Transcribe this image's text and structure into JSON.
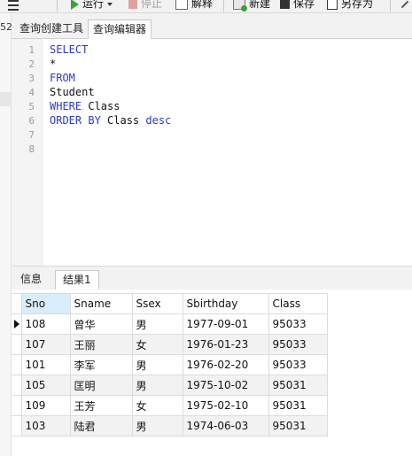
{
  "toolbar": {
    "run_label": "运行",
    "stop_label": "停止",
    "explain_label": "解释",
    "new_label": "新建",
    "save_label": "保存",
    "save_as_label": "另存为"
  },
  "left_panel": {
    "partial_text": "52"
  },
  "query_tabs": [
    {
      "label": "查询创建工具",
      "active": false
    },
    {
      "label": "查询编辑器",
      "active": true
    }
  ],
  "editor": {
    "line_numbers": [
      "1",
      "2",
      "3",
      "4",
      "5",
      "6",
      "7",
      "8"
    ],
    "lines": [
      [
        {
          "t": "SELECT",
          "kw": true
        }
      ],
      [
        {
          "t": "*",
          "kw": false
        }
      ],
      [
        {
          "t": "FROM",
          "kw": true
        }
      ],
      [
        {
          "t": "Student",
          "kw": false
        }
      ],
      [
        {
          "t": "WHERE",
          "kw": true
        },
        {
          "t": " Class",
          "kw": false
        }
      ],
      [
        {
          "t": "ORDER BY",
          "kw": true
        },
        {
          "t": " Class ",
          "kw": false
        },
        {
          "t": "desc",
          "kw": true
        }
      ],
      [],
      []
    ],
    "keyword_color": "#2b3cc2"
  },
  "result_tabs": [
    {
      "label": "信息",
      "active": false
    },
    {
      "label": "结果1",
      "active": true
    }
  ],
  "grid": {
    "columns": [
      "Sno",
      "Sname",
      "Ssex",
      "Sbirthday",
      "Class"
    ],
    "rows": [
      [
        "108",
        "曾华",
        "男",
        "1977-09-01",
        "95033"
      ],
      [
        "107",
        "王丽",
        "女",
        "1976-01-23",
        "95033"
      ],
      [
        "101",
        "李军",
        "男",
        "1976-02-20",
        "95033"
      ],
      [
        "105",
        "匡明",
        "男",
        "1975-10-02",
        "95031"
      ],
      [
        "109",
        "王芳",
        "女",
        "1975-02-10",
        "95031"
      ],
      [
        "103",
        "陆君",
        "男",
        "1974-06-03",
        "95031"
      ]
    ],
    "current_row": 0,
    "selected_column": 0
  }
}
